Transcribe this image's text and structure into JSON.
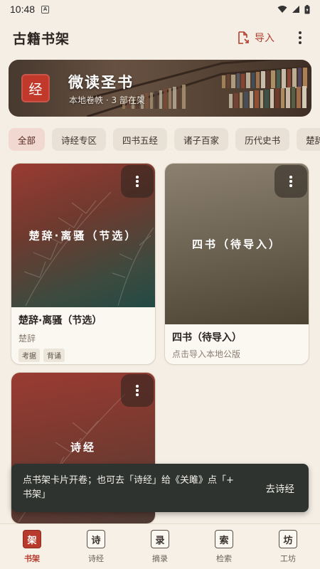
{
  "status_bar": {
    "time": "10:48"
  },
  "app_bar": {
    "title": "古籍书架",
    "import_label": "导入"
  },
  "hero": {
    "seal": "经",
    "title": "微读圣书",
    "subtitle": "本地卷帙 · 3 部在架"
  },
  "chips": [
    "全部",
    "诗经专区",
    "四书五经",
    "诸子百家",
    "历代史书",
    "楚辞"
  ],
  "books": [
    {
      "cover_title": "楚辞·离骚（节选）",
      "title": "楚辞·离骚（节选）",
      "subtitle": "楚辞",
      "tags": [
        "考据",
        "背诵"
      ]
    },
    {
      "cover_title": "四书（待导入）",
      "title": "四书（待导入）",
      "subtitle": "点击导入本地公版",
      "tags": []
    },
    {
      "cover_title": "诗经",
      "title": "诗经",
      "subtitle": "",
      "tags": []
    }
  ],
  "snackbar": {
    "message": "点书架卡片开卷；也可去「诗经」给《关雎》点「+ 书架」",
    "action": "去诗经"
  },
  "bottom_nav": [
    {
      "glyph": "架",
      "label": "书架"
    },
    {
      "glyph": "诗",
      "label": "诗经"
    },
    {
      "glyph": "录",
      "label": "摘录"
    },
    {
      "glyph": "索",
      "label": "检索"
    },
    {
      "glyph": "坊",
      "label": "工坊"
    }
  ],
  "colors": {
    "accent": "#b83a2d",
    "background": "#f4eee4",
    "snackbar": "#2e332f"
  },
  "icons": [
    "wifi-icon",
    "signal-icon",
    "battery-icon",
    "import-file-icon",
    "more-vert-icon"
  ]
}
